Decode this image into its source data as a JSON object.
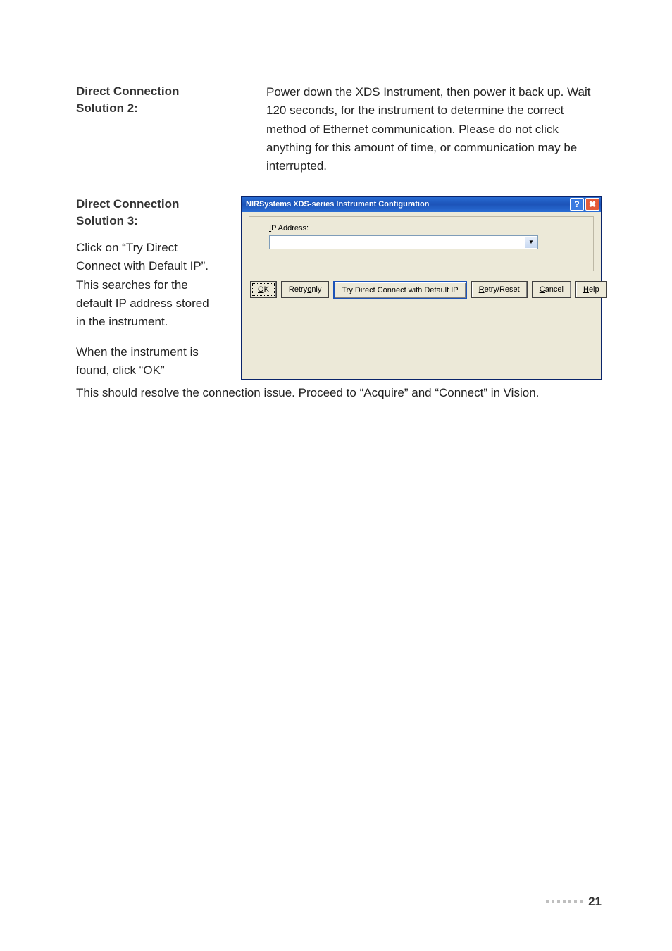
{
  "section2": {
    "heading": "Direct Connection Solution 2:",
    "body": "Power down the XDS Instrument, then power it back up. Wait 120 seconds, for the instrument to determine the correct method of Ethernet communication. Please do not click anything for this amount of time, or communication may be interrupted."
  },
  "section3": {
    "heading": "Direct Connection Solution 3:",
    "body": "Click on “Try Direct Connect with Default IP”. This searches for the default IP address stored in the instrument.",
    "body2": "When the instrument is found, click “OK”"
  },
  "closing": "This should resolve the connection issue. Proceed to “Acquire” and “Connect” in Vision.",
  "dialog": {
    "title": "NIRSystems XDS-series Instrument Configuration",
    "ip_label_prefix": "I",
    "ip_label_rest": "P Address:",
    "combo_value": "",
    "buttons": {
      "ok_u": "O",
      "ok_rest": "K",
      "retry_only_pre": "Retry ",
      "retry_only_u": "o",
      "retry_only_post": "nly",
      "try_default": "Try Direct Connect with Default IP",
      "retry_reset_u": "R",
      "retry_reset_rest": "etry/Reset",
      "cancel_u": "C",
      "cancel_rest": "ancel",
      "help_u": "H",
      "help_rest": "elp"
    },
    "help_glyph": "?",
    "close_glyph": "✖"
  },
  "page_number": "21"
}
